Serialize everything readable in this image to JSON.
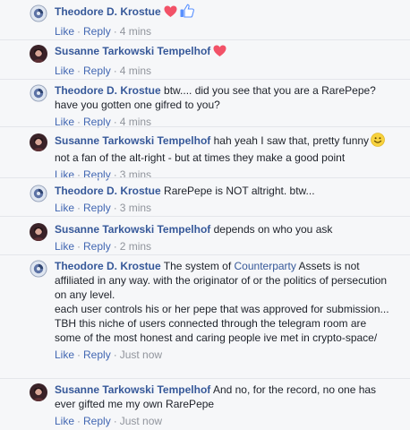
{
  "comments": [
    {
      "author": "Theodore D. Krostue",
      "avatar": "theodore",
      "segments": [],
      "reactions": [
        "heart-icon",
        "like-thumb-icon"
      ],
      "actions": {
        "like": "Like",
        "reply": "Reply",
        "time": "4 mins"
      }
    },
    {
      "author": "Susanne Tarkowski Tempelhof",
      "avatar": "susanne",
      "segments": [],
      "reactions": [
        "heart-icon"
      ],
      "actions": {
        "like": "Like",
        "reply": "Reply",
        "time": "4 mins"
      }
    },
    {
      "author": "Theodore D. Krostue",
      "avatar": "theodore",
      "segments": [
        {
          "text": " btw.... did you see that you are a RarePepe? have you gotten one gifred to you?"
        }
      ],
      "reactions": [],
      "actions": {
        "like": "Like",
        "reply": "Reply",
        "time": "4 mins"
      }
    },
    {
      "author": "Susanne Tarkowski Tempelhof",
      "avatar": "susanne",
      "segments": [
        {
          "text": " hah yeah I saw that, pretty funny"
        },
        {
          "emoji": "smiley-icon"
        },
        {
          "text": " not a fan of the alt-right - but at times they make a good point"
        }
      ],
      "reactions": [],
      "actions": {
        "like": "Like",
        "reply": "Reply",
        "time": "3 mins"
      }
    },
    {
      "author": "Theodore D. Krostue",
      "avatar": "theodore",
      "segments": [
        {
          "text": " RarePepe is NOT altright. btw..."
        }
      ],
      "reactions": [],
      "actions": {
        "like": "Like",
        "reply": "Reply",
        "time": "3 mins"
      }
    },
    {
      "author": "Susanne Tarkowski Tempelhof",
      "avatar": "susanne",
      "segments": [
        {
          "text": " depends on who you ask"
        }
      ],
      "reactions": [],
      "actions": {
        "like": "Like",
        "reply": "Reply",
        "time": "2 mins"
      }
    },
    {
      "author": "Theodore D. Krostue",
      "avatar": "theodore",
      "segments": [
        {
          "text": " The system of "
        },
        {
          "link": "Counterparty"
        },
        {
          "text": " Assets is not affiliated in any way. with the originator of or the politics of persecution on any level."
        },
        {
          "break": true
        },
        {
          "text": "each user controls his or her pepe that was approved for submission... TBH this niche of users connected through the telegram room are some of the most honest and caring people ive met in crypto-space/"
        }
      ],
      "reactions": [],
      "actions": {
        "like": "Like",
        "reply": "Reply",
        "time": "Just now"
      }
    },
    {
      "author": "Susanne Tarkowski Tempelhof",
      "avatar": "susanne",
      "segments": [
        {
          "text": " And no, for the record, no one has ever gifted me my own RarePepe"
        }
      ],
      "reactions": [],
      "actions": {
        "like": "Like",
        "reply": "Reply",
        "time": "Just now"
      }
    }
  ],
  "colors": {
    "author": "#365899",
    "action": "#4267b2",
    "muted": "#90949c",
    "heart": "#f25268",
    "like": "#5890ff",
    "smiley": "#f7d23e"
  }
}
